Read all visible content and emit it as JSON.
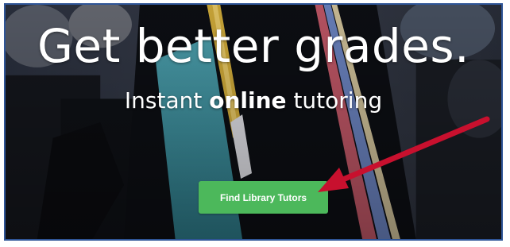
{
  "hero": {
    "title": "Get better grades.",
    "subtitle_prefix": "Instant ",
    "subtitle_emphasis": "online",
    "subtitle_suffix": " tutoring"
  },
  "cta": {
    "label": "Find Library Tutors"
  },
  "colors": {
    "frame_border": "#2f5597",
    "cta_background": "#4cb85b",
    "annotation_arrow": "#c8102e"
  },
  "icons": {
    "annotation": "red-arrow-icon"
  }
}
